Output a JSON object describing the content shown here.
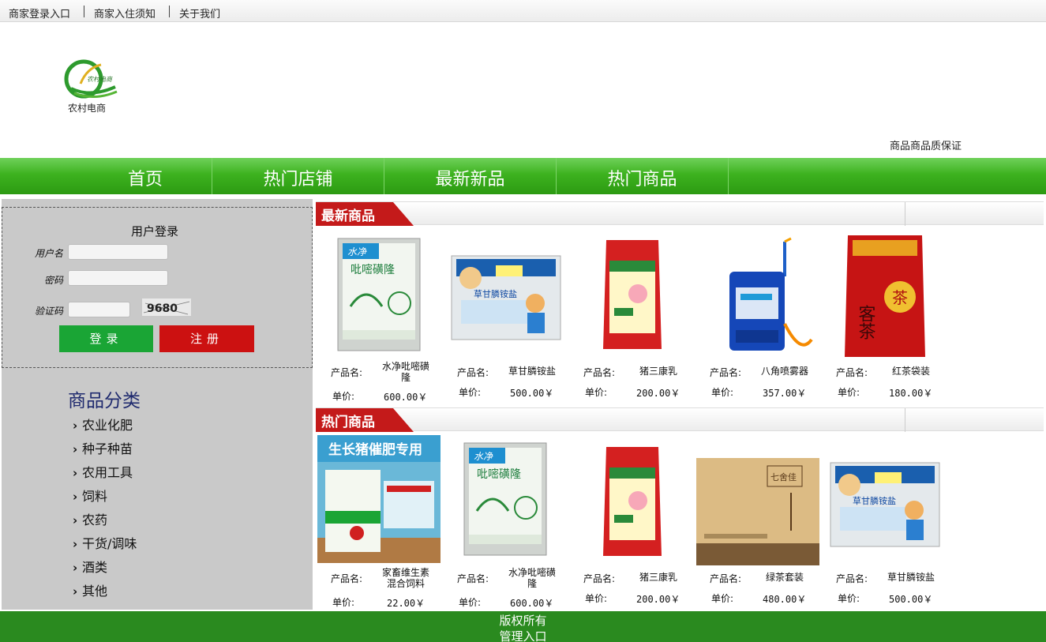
{
  "topbar": {
    "links": [
      "商家登录入口",
      "商家入住须知",
      "关于我们"
    ]
  },
  "logo": {
    "text": "农村电商",
    "emblem_text": "农村电商"
  },
  "header": {
    "quality": "商品商品质保证"
  },
  "nav": {
    "items": [
      "首页",
      "热门店铺",
      "最新新品",
      "热门商品"
    ]
  },
  "login": {
    "title": "用户登录",
    "username_label": "用户名",
    "password_label": "密码",
    "captcha_label": "验证码",
    "captcha_value": "9680",
    "login_button": "登录",
    "register_button": "注册"
  },
  "categories": {
    "title": "商品分类",
    "items": [
      "农业化肥",
      "种子种苗",
      "农用工具",
      "饲料",
      "农药",
      "干货/调味",
      "酒类",
      "其他"
    ]
  },
  "sections": {
    "newest": {
      "title": "最新商品",
      "products": [
        {
          "name": "水净吡嘧磺隆",
          "price": "600.00￥",
          "icon": "herbicide-bag"
        },
        {
          "name": "草甘膦铵盐",
          "price": "500.00￥",
          "icon": "herbicide-pack"
        },
        {
          "name": "猪三康乳",
          "price": "200.00￥",
          "icon": "feed-bag"
        },
        {
          "name": "八角喷雾器",
          "price": "357.00￥",
          "icon": "sprayer"
        },
        {
          "name": "红茶袋装",
          "price": "180.00￥",
          "icon": "tea-bag"
        }
      ]
    },
    "hot": {
      "title": "热门商品",
      "products": [
        {
          "name": "家畜维生素混合饲料",
          "price": "22.00￥",
          "icon": "pig-feed"
        },
        {
          "name": "水净吡嘧磺隆",
          "price": "600.00￥",
          "icon": "herbicide-bag"
        },
        {
          "name": "猪三康乳",
          "price": "200.00￥",
          "icon": "feed-bag"
        },
        {
          "name": "绿茶套装",
          "price": "480.00￥",
          "icon": "tea-box"
        },
        {
          "name": "草甘膦铵盐",
          "price": "500.00￥",
          "icon": "herbicide-pack"
        }
      ]
    },
    "name_label": "产品名:",
    "price_label": "单价:"
  },
  "product_art": {
    "herbicide_brand": "水净",
    "herbicide_name": "吡嘧磺隆",
    "glyphosate_name": "草甘膦铵盐",
    "tea_char": "茶",
    "tea_brand": "客茶",
    "pig_feed_banner": "生长猪催肥专用",
    "tea_box_brand": "七舍佳"
  },
  "footer": {
    "copyright": "版权所有",
    "admin": "管理入口"
  },
  "colors": {
    "nav_green": "#3db21f",
    "footer_green": "#2a8a1f",
    "login_green": "#1aa535",
    "register_red": "#cc1111",
    "section_red": "#c41a1a",
    "category_title": "#1f2a6e"
  }
}
